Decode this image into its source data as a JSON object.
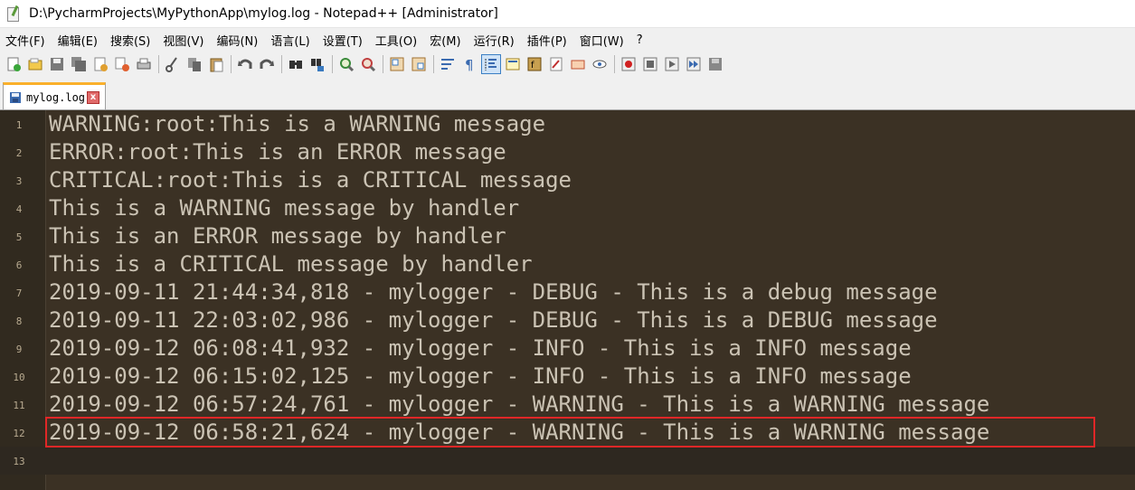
{
  "window": {
    "title": "D:\\PycharmProjects\\MyPythonApp\\mylog.log - Notepad++ [Administrator]"
  },
  "menu": [
    "文件(F)",
    "编辑(E)",
    "搜索(S)",
    "视图(V)",
    "编码(N)",
    "语言(L)",
    "设置(T)",
    "工具(O)",
    "宏(M)",
    "运行(R)",
    "插件(P)",
    "窗口(W)",
    "?"
  ],
  "toolbar_icons": [
    "new-file-icon",
    "open-file-icon",
    "save-icon",
    "save-all-icon",
    "close-icon",
    "close-all-icon",
    "print-icon",
    "cut-icon",
    "copy-icon",
    "paste-icon",
    "undo-icon",
    "redo-icon",
    "find-icon",
    "replace-icon",
    "zoom-in-icon",
    "zoom-out-icon",
    "sync-vertical-icon",
    "sync-horizontal-icon",
    "word-wrap-icon",
    "show-all-chars-icon",
    "indent-guide-icon",
    "doc-map-icon",
    "function-list-icon",
    "folder-as-workspace-icon",
    "monitoring-icon",
    "eye-icon",
    "record-macro-icon",
    "stop-macro-icon",
    "play-macro-icon",
    "run-macro-multiple-icon",
    "save-macro-icon"
  ],
  "tab": {
    "label": "mylog.log",
    "close": "x"
  },
  "editor": {
    "lines": [
      {
        "num": "1",
        "text": "WARNING:root:This is a WARNING message"
      },
      {
        "num": "2",
        "text": "ERROR:root:This is an ERROR message"
      },
      {
        "num": "3",
        "text": "CRITICAL:root:This is a CRITICAL message"
      },
      {
        "num": "4",
        "text": "This is a WARNING message by handler"
      },
      {
        "num": "5",
        "text": "This is an ERROR message by handler"
      },
      {
        "num": "6",
        "text": "This is a CRITICAL message by handler"
      },
      {
        "num": "7",
        "text": "2019-09-11 21:44:34,818 - mylogger - DEBUG - This is a debug message"
      },
      {
        "num": "8",
        "text": "2019-09-11 22:03:02,986 - mylogger - DEBUG - This is a DEBUG message"
      },
      {
        "num": "9",
        "text": "2019-09-12 06:08:41,932 - mylogger - INFO - This is a INFO message"
      },
      {
        "num": "10",
        "text": "2019-09-12 06:15:02,125 - mylogger - INFO - This is a INFO message"
      },
      {
        "num": "11",
        "text": "2019-09-12 06:57:24,761 - mylogger - WARNING - This is a WARNING message"
      },
      {
        "num": "12",
        "text": "2019-09-12 06:58:21,624 - mylogger - WARNING - This is a WARNING message"
      },
      {
        "num": "13",
        "text": ""
      }
    ],
    "highlighted_line": "12",
    "highlight_color": "#e02727",
    "background": "#3b3124",
    "text_color": "#cbc3b4"
  }
}
